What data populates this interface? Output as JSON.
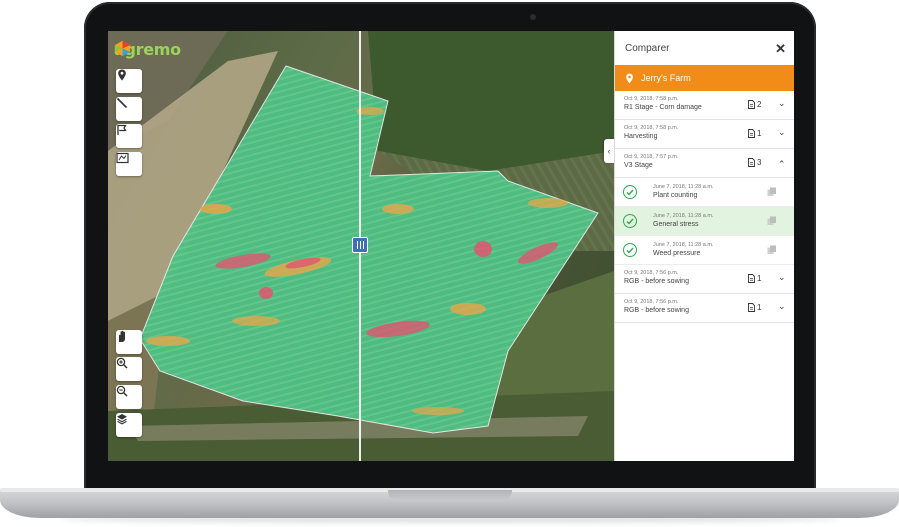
{
  "app": {
    "logo_text": "agremo",
    "brand_color": "#9bd35a",
    "accent_color": "#f28c18"
  },
  "toolbar": {
    "top_tools": [
      {
        "icon": "map-pin-icon"
      },
      {
        "icon": "line-measure-icon"
      },
      {
        "icon": "flag-icon"
      },
      {
        "icon": "area-map-icon"
      }
    ],
    "bottom_tools": [
      {
        "icon": "hand-pan-icon"
      },
      {
        "icon": "zoom-in-icon"
      },
      {
        "icon": "zoom-out-icon"
      },
      {
        "icon": "layers-icon"
      }
    ]
  },
  "panel": {
    "title": "Comparer",
    "close_glyph": "✕",
    "collapse_glyph": "‹",
    "farm": {
      "name": "Jerry's Farm",
      "icon": "map-pin-icon"
    },
    "reports": [
      {
        "date": "Oct 9, 2018, 7:58 p.m.",
        "title": "R1 Stage - Corn damage",
        "count": "2",
        "expanded": false
      },
      {
        "date": "Oct 9, 2018, 7:58 p.m.",
        "title": "Harvesting",
        "count": "1",
        "expanded": false
      },
      {
        "date": "Oct 9, 2018, 7:57 p.m.",
        "title": "V3 Stage",
        "count": "3",
        "expanded": true
      },
      {
        "date": "Oct 9, 2018, 7:56 p.m.",
        "title": "RGB - before sowing",
        "count": "1",
        "expanded": false
      },
      {
        "date": "Oct 9, 2018, 7:56 p.m.",
        "title": "RGB - before sowing",
        "count": "1",
        "expanded": false
      }
    ],
    "sub_items": [
      {
        "date": "June 7, 2018, 11:28 a.m.",
        "title": "Plant counting",
        "active": false
      },
      {
        "date": "June 7, 2018, 11:28 a.m.",
        "title": "General stress",
        "active": true
      },
      {
        "date": "June 7, 2018, 11:28 a.m.",
        "title": "Weed pressure",
        "active": false
      }
    ]
  }
}
